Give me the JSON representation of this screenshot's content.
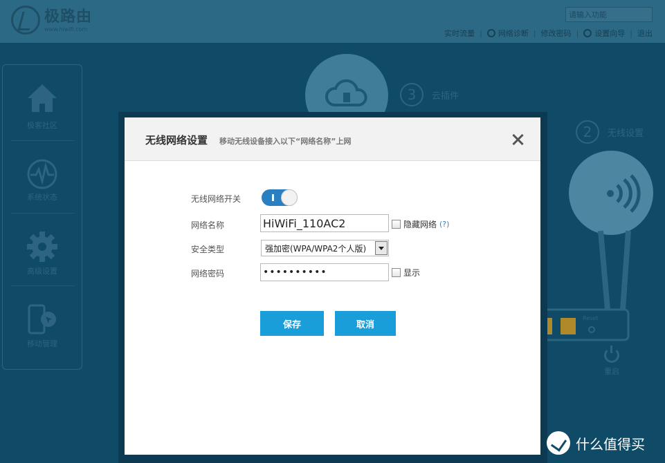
{
  "brand": {
    "name": "极路由",
    "url": "www.hiwifi.com"
  },
  "search": {
    "placeholder": "请输入功能"
  },
  "topnav": [
    "实时流量",
    "网络诊断",
    "修改密码",
    "设置向导",
    "退出"
  ],
  "sidebar": [
    {
      "label": "极客社区",
      "icon": "home-icon"
    },
    {
      "label": "系统状态",
      "icon": "pulse-icon"
    },
    {
      "label": "高级设置",
      "icon": "gear-icon"
    },
    {
      "label": "移动管理",
      "icon": "mobile-icon"
    }
  ],
  "background": {
    "step3": {
      "number": "3",
      "label": "云插件"
    },
    "step2": {
      "number": "2",
      "label": "无线设置"
    },
    "reset_label": "Reset",
    "restart_label": "重启"
  },
  "modal": {
    "title": "无线网络设置",
    "subtitle": "移动无线设备接入以下“网络名称”上网",
    "fields": {
      "switch_label": "无线网络开关",
      "switch_on": true,
      "ssid_label": "网络名称",
      "ssid_value": "HiWiFi_110AC2",
      "hide_label": "隐藏网络",
      "help_text": "(?)",
      "security_label": "安全类型",
      "security_value": "强加密(WPA/WPA2个人版)",
      "password_label": "网络密码",
      "password_value": "••••••••••",
      "show_label": "显示"
    },
    "save_label": "保存",
    "cancel_label": "取消"
  },
  "watermark": {
    "text": "什么值得买"
  },
  "colors": {
    "accent": "#1a9ed9",
    "toggle": "#2a7fc0",
    "background": "#0f4a66"
  }
}
